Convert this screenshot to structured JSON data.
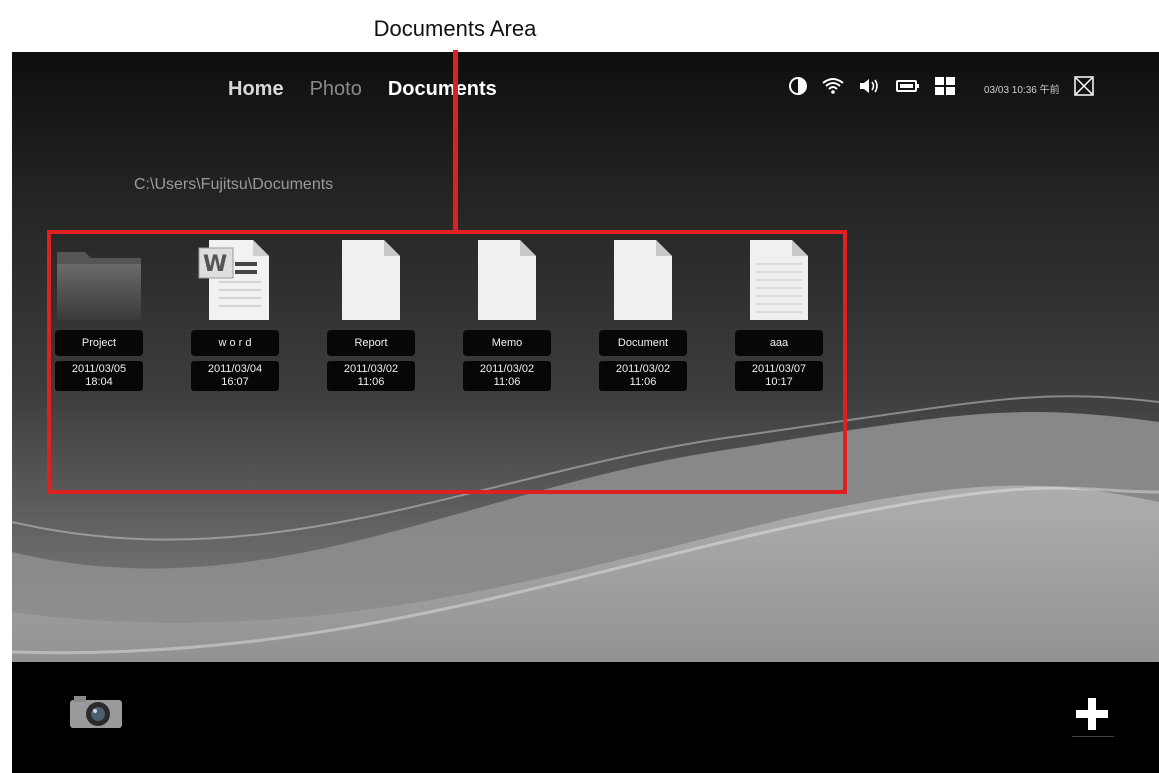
{
  "annotation": {
    "label": "Documents Area"
  },
  "nav": {
    "home": "Home",
    "photo": "Photo",
    "documents": "Documents"
  },
  "status": {
    "icons": [
      "brightness-icon",
      "wifi-icon",
      "volume-icon",
      "battery-icon",
      "grid-icon",
      "close-icon"
    ],
    "datetime": "03/03 10:36 午前"
  },
  "path": "C:\\Users\\Fujitsu\\Documents",
  "files": [
    {
      "name": "Project",
      "date": "2011/03/05",
      "time": "18:04",
      "icon": "folder-icon"
    },
    {
      "name": "w o r d",
      "date": "2011/03/04",
      "time": "16:07",
      "icon": "word-document-icon"
    },
    {
      "name": "Report",
      "date": "2011/03/02",
      "time": "11:06",
      "icon": "blank-document-icon"
    },
    {
      "name": "Memo",
      "date": "2011/03/02",
      "time": "11:06",
      "icon": "blank-document-icon"
    },
    {
      "name": "Document",
      "date": "2011/03/02",
      "time": "11:06",
      "icon": "blank-document-icon"
    },
    {
      "name": "aaa",
      "date": "2011/03/07",
      "time": "10:17",
      "icon": "text-document-icon"
    }
  ],
  "bottom_bar": {
    "left_icon": "camera-icon",
    "right_icon": "plus-icon"
  },
  "colors": {
    "annotation": "#e02020",
    "background": "#000000"
  }
}
